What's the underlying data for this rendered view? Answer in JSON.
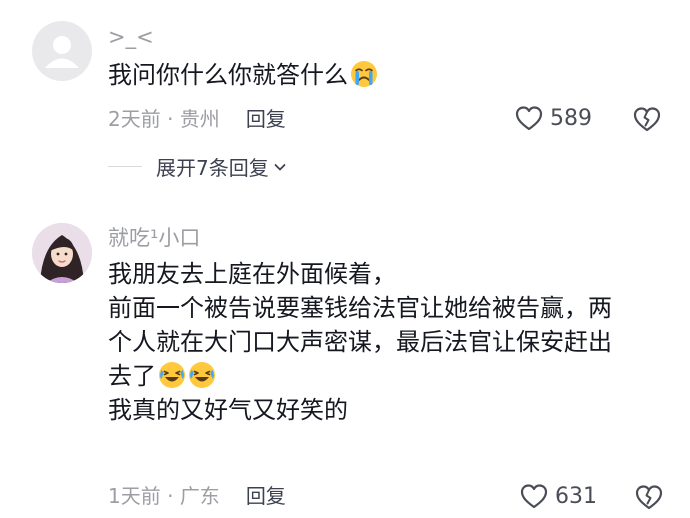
{
  "comments": [
    {
      "username": ">_<",
      "text": "我问你什么你就答什么",
      "emoji_names": [
        "crying-emoji"
      ],
      "time": "2天前",
      "location": "贵州",
      "reply_label": "回复",
      "likes": "589",
      "expand_label": "展开7条回复"
    },
    {
      "username": "就吃¹小口",
      "lines": [
        "我朋友去上庭在外面候着，",
        "前面一个被告说要塞钱给法官让她给被告赢，两",
        "个人就在大门口大声密谋，最后法官让保安赶出",
        "去了",
        "我真的又好气又好笑的"
      ],
      "emoji_names": [
        "laughing-crying-emoji",
        "laughing-crying-emoji"
      ],
      "time": "1天前",
      "location": "广东",
      "reply_label": "回复",
      "likes": "631"
    }
  ],
  "separator": " · ",
  "colors": {
    "text": "#151820",
    "muted": "#9d9ea4",
    "action": "#3e4150",
    "emoji": "#ffc83d",
    "tear": "#3fa7f5"
  }
}
